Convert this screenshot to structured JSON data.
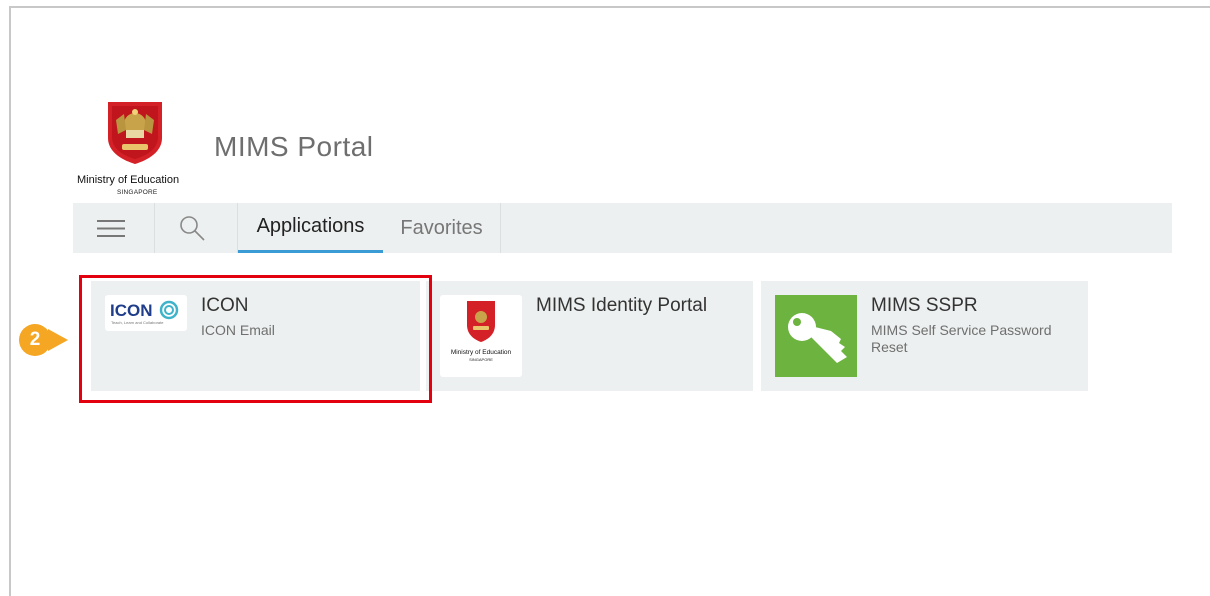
{
  "organization": {
    "name": "Ministry of Education",
    "sub_name": "SINGAPORE"
  },
  "portal": {
    "title": "MIMS Portal"
  },
  "nav": {
    "menu_icon": "hamburger-icon",
    "search_icon": "search-icon",
    "tabs": [
      {
        "label": "Applications",
        "active": true
      },
      {
        "label": "Favorites",
        "active": false
      }
    ]
  },
  "apps": [
    {
      "title": "ICON",
      "description": "ICON Email",
      "icon": "icon-logo",
      "logo_text": "ICON",
      "logo_tagline": "Teach, Learn and Collaborate"
    },
    {
      "title": "MIMS Identity Portal",
      "description": "",
      "icon": "moe-crest-logo",
      "logo_text": "Ministry of Education",
      "logo_sub": "SINGAPORE"
    },
    {
      "title": "MIMS SSPR",
      "description": "MIMS Self Service Password Reset",
      "icon": "key-icon"
    }
  ],
  "annotation": {
    "step_number": "2",
    "color_badge": "#f5a623",
    "color_highlight": "#e3000f"
  },
  "colors": {
    "accent": "#3a9bd5",
    "nav_bg": "#edf0f0",
    "tile_bg": "#edf0f0",
    "sspr_green": "#6db33f"
  }
}
